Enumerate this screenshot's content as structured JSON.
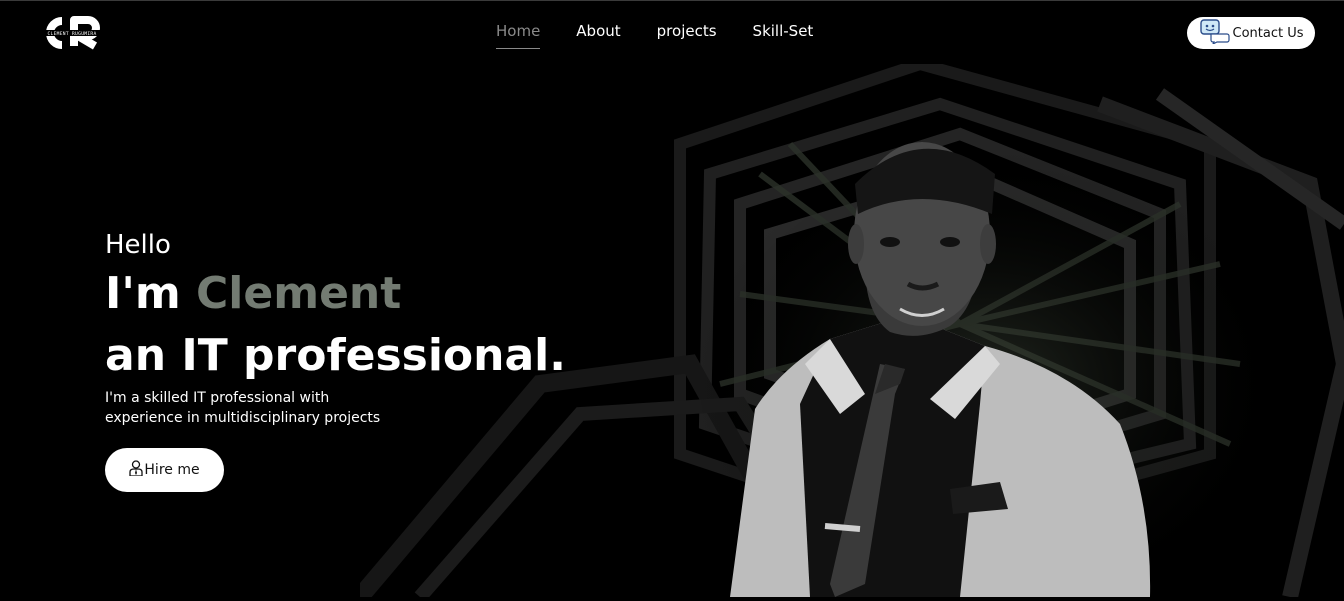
{
  "brand": {
    "logo_text": "CR",
    "logo_subtext": "CLEMENT RUGUMIRA"
  },
  "nav": {
    "items": [
      {
        "label": "Home",
        "active": true
      },
      {
        "label": "About",
        "active": false
      },
      {
        "label": "projects",
        "active": false
      },
      {
        "label": "Skill-Set",
        "active": false
      }
    ]
  },
  "header": {
    "contact_label": "Contact Us",
    "contact_icon": "chat-bubble-icon"
  },
  "hero": {
    "greeting": "Hello",
    "intro_prefix": "I'm ",
    "name": "Clement",
    "role": "an IT professional.",
    "description": "I'm a skilled IT professional with experience in multidisciplinary projects",
    "hire_label": "Hire me",
    "hire_icon": "person-icon"
  },
  "colors": {
    "background": "#000000",
    "accent": "#737b72",
    "button_bg": "#ffffff"
  }
}
